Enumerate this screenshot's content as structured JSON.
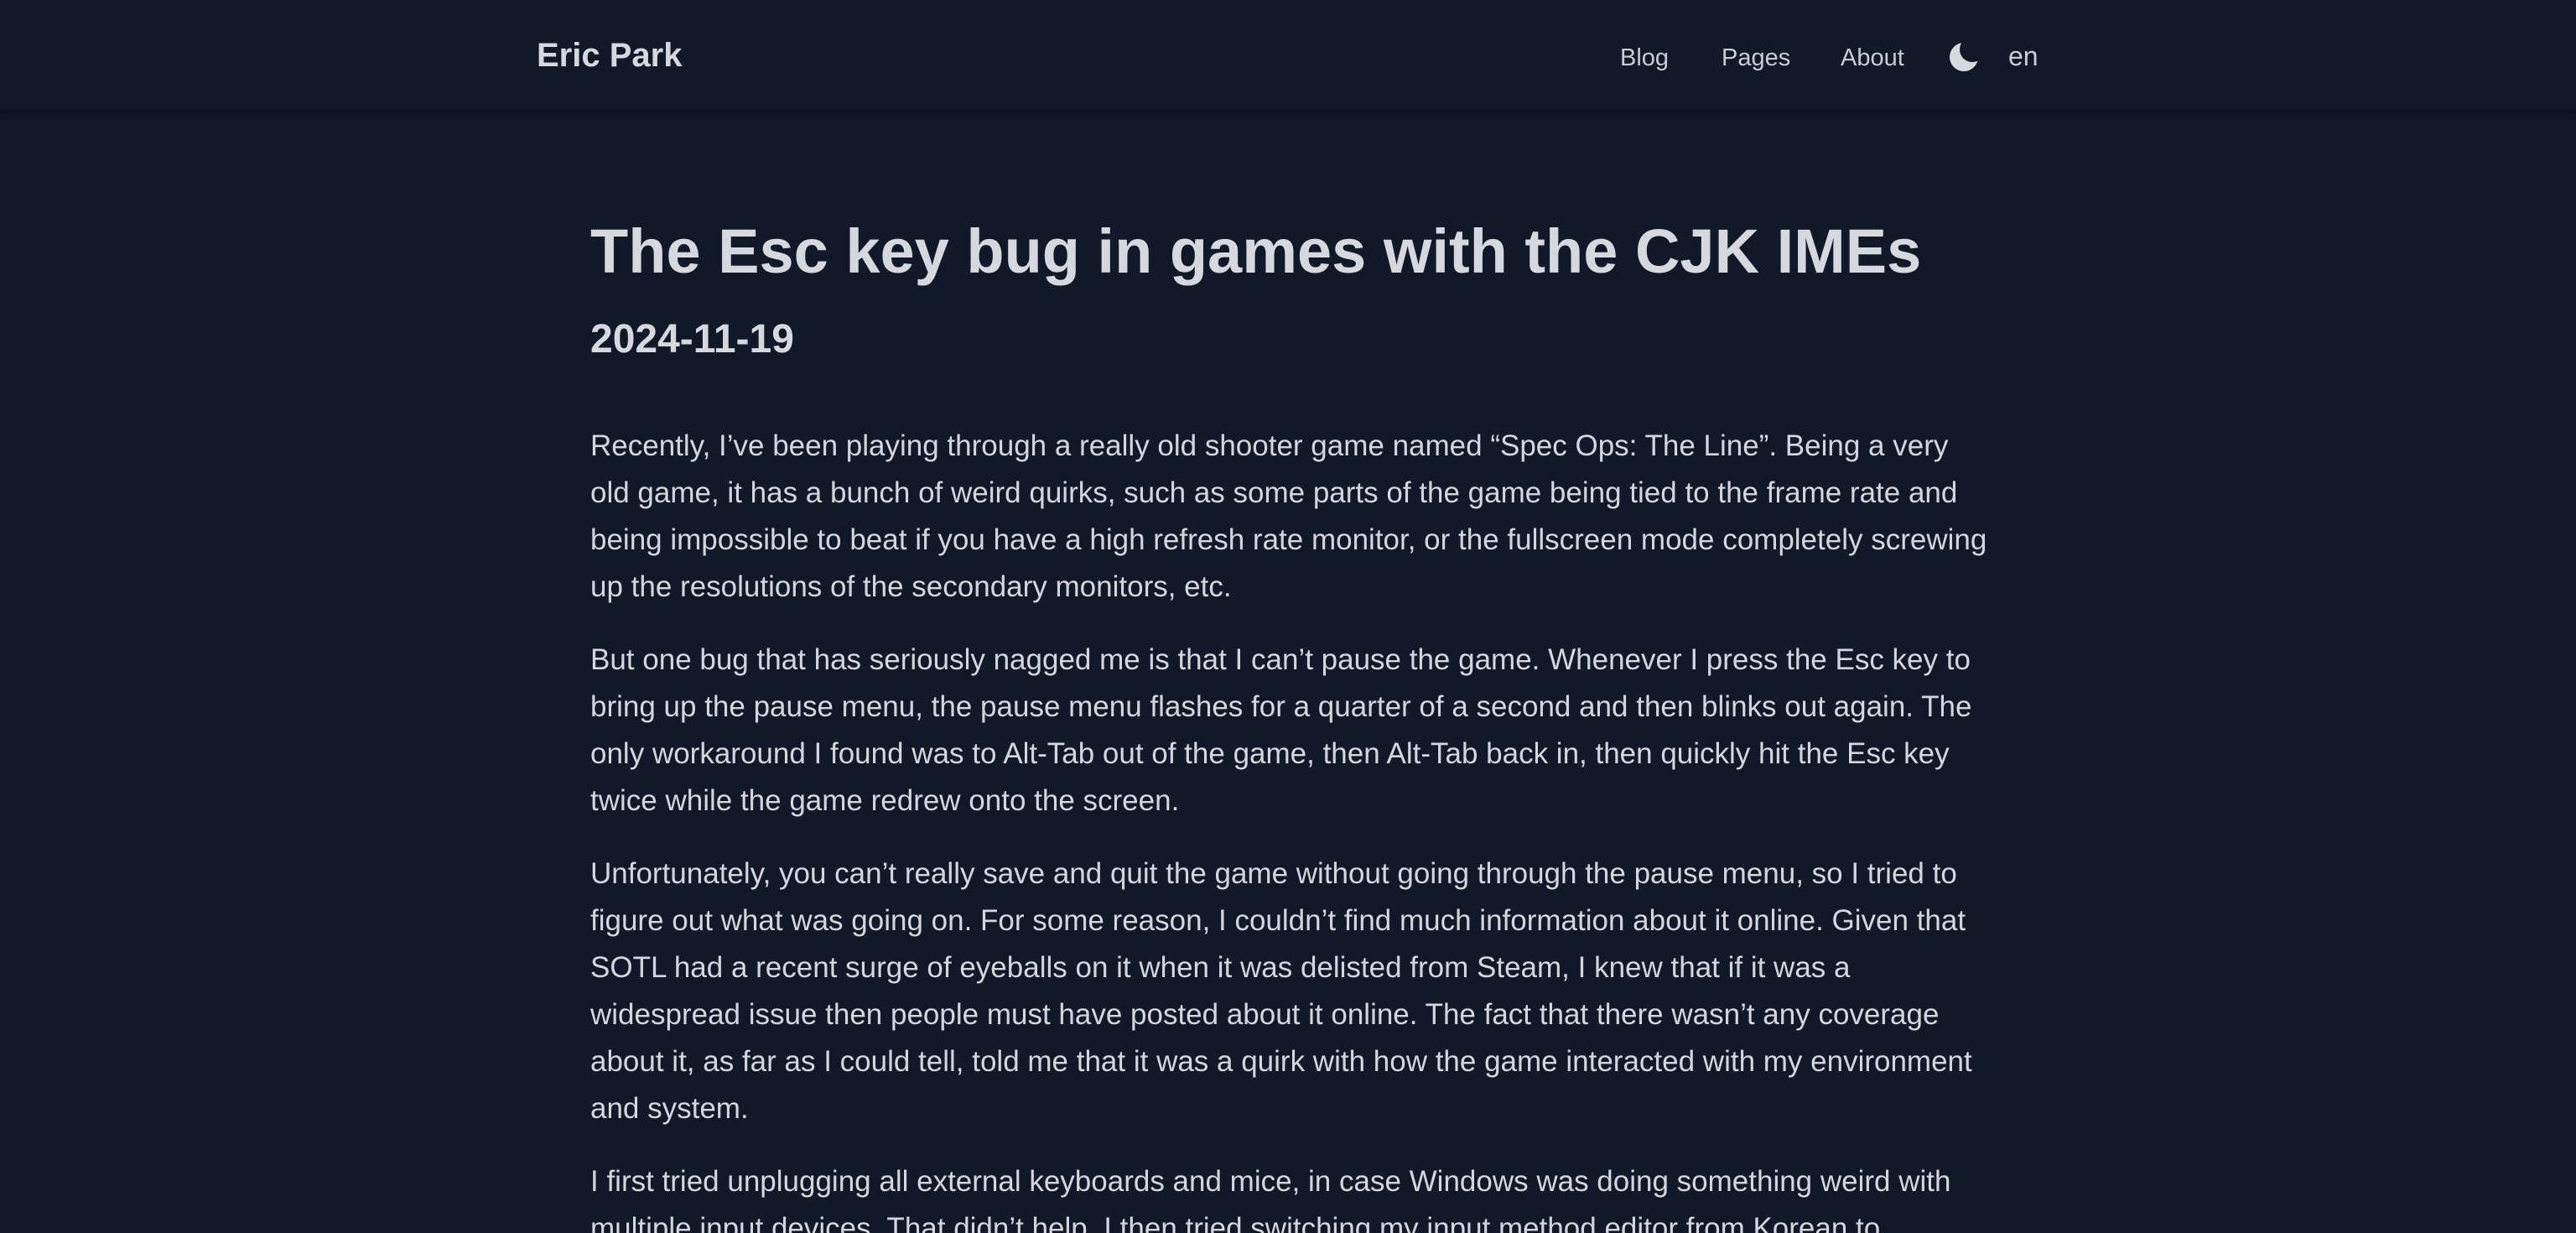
{
  "header": {
    "site_title": "Eric Park",
    "nav": {
      "blog": "Blog",
      "pages": "Pages",
      "about": "About"
    },
    "theme_icon": "moon-icon",
    "language": "en"
  },
  "post": {
    "title": "The Esc key bug in games with the CJK IMEs",
    "date": "2024-11-19",
    "paragraphs": [
      "Recently, I’ve been playing through a really old shooter game named “Spec Ops: The Line”. Being a very old game, it has a bunch of weird quirks, such as some parts of the game being tied to the frame rate and being impossible to beat if you have a high refresh rate monitor, or the fullscreen mode completely screwing up the resolutions of the secondary monitors, etc.",
      "But one bug that has seriously nagged me is that I can’t pause the game. Whenever I press the Esc key to bring up the pause menu, the pause menu flashes for a quarter of a second and then blinks out again. The only workaround I found was to Alt-Tab out of the game, then Alt-Tab back in, then quickly hit the Esc key twice while the game redrew onto the screen.",
      "Unfortunately, you can’t really save and quit the game without going through the pause menu, so I tried to figure out what was going on. For some reason, I couldn’t find much information about it online. Given that SOTL had a recent surge of eyeballs on it when it was delisted from Steam, I knew that if it was a widespread issue then people must have posted about it online. The fact that there wasn’t any coverage about it, as far as I could tell, told me that it was a quirk with how the game interacted with my environment and system.",
      "I first tried unplugging all external keyboards and mice, in case Windows was doing something weird with multiple input devices. That didn’t help. I then tried switching my input method editor from Korean to"
    ]
  },
  "colors": {
    "background": "#111827",
    "text": "#d4d6dc",
    "heading": "#d6d8de"
  }
}
